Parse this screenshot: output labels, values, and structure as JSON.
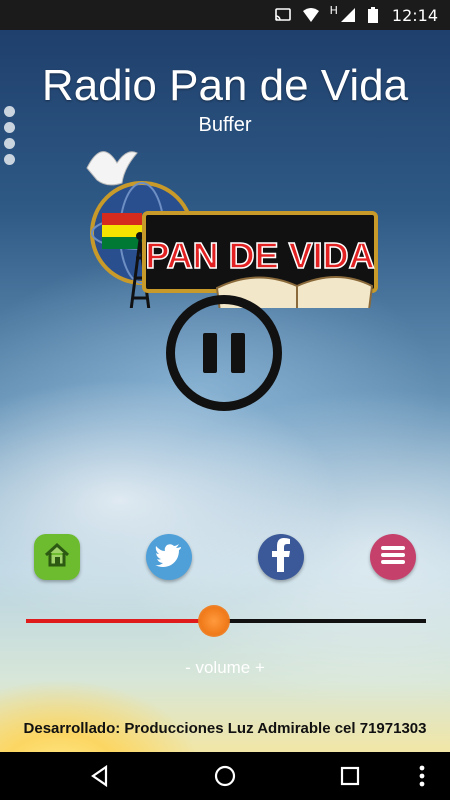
{
  "status_bar": {
    "time": "12:14",
    "icons": [
      "cast-icon",
      "wifi-icon",
      "signal-h-icon",
      "signal-icon",
      "battery-icon"
    ],
    "network_label": "H"
  },
  "app": {
    "title": "Radio Pan de Vida",
    "status": "Buffer",
    "logo_text": "PAN DE VIDA",
    "playback_state": "playing",
    "volume": {
      "label": "- volume +",
      "level": 0.47
    },
    "social": [
      "home-icon",
      "twitter-icon",
      "facebook-icon",
      "menu-icon"
    ],
    "credits": "Desarrollado: Producciones Luz Admirable cel 71971303"
  },
  "nav_bar": {
    "buttons": [
      "back-icon",
      "home-icon",
      "recents-icon",
      "more-icon"
    ]
  },
  "colors": {
    "accent_red": "#e01b1b",
    "thumb_orange": "#f07a1a"
  }
}
